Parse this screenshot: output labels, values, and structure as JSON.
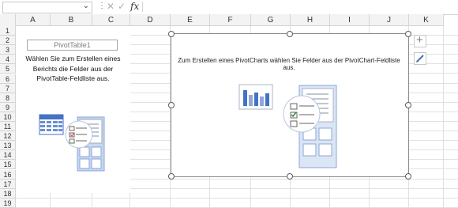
{
  "formula_bar": {
    "name_box_value": "",
    "separator": "⋮",
    "cancel_glyph": "✕",
    "enter_glyph": "✓",
    "fx_label": "fx",
    "formula_value": ""
  },
  "columns": [
    "A",
    "B",
    "C",
    "D",
    "E",
    "F",
    "G",
    "H",
    "I",
    "J",
    "K"
  ],
  "rows": [
    "1",
    "2",
    "3",
    "4",
    "5",
    "6",
    "7",
    "8",
    "9",
    "10",
    "11",
    "12",
    "13",
    "14",
    "15",
    "16",
    "17",
    "18",
    "19"
  ],
  "pivot": {
    "name": "PivotTable1",
    "instruction": "Wählen Sie zum Erstellen eines Berichts die Felder aus der PivotTable-Feldliste aus."
  },
  "chart": {
    "instruction": "Zum Erstellen eines PivotCharts wählen Sie Felder aus der PivotChart-Feldliste aus."
  },
  "side_buttons": [
    {
      "icon": "plus-icon",
      "glyph": "+"
    },
    {
      "icon": "brush-icon"
    }
  ],
  "colors": {
    "accent_blue": "#4472c4",
    "header_bg": "#f3f3f3",
    "grid": "#e1e1e1"
  }
}
